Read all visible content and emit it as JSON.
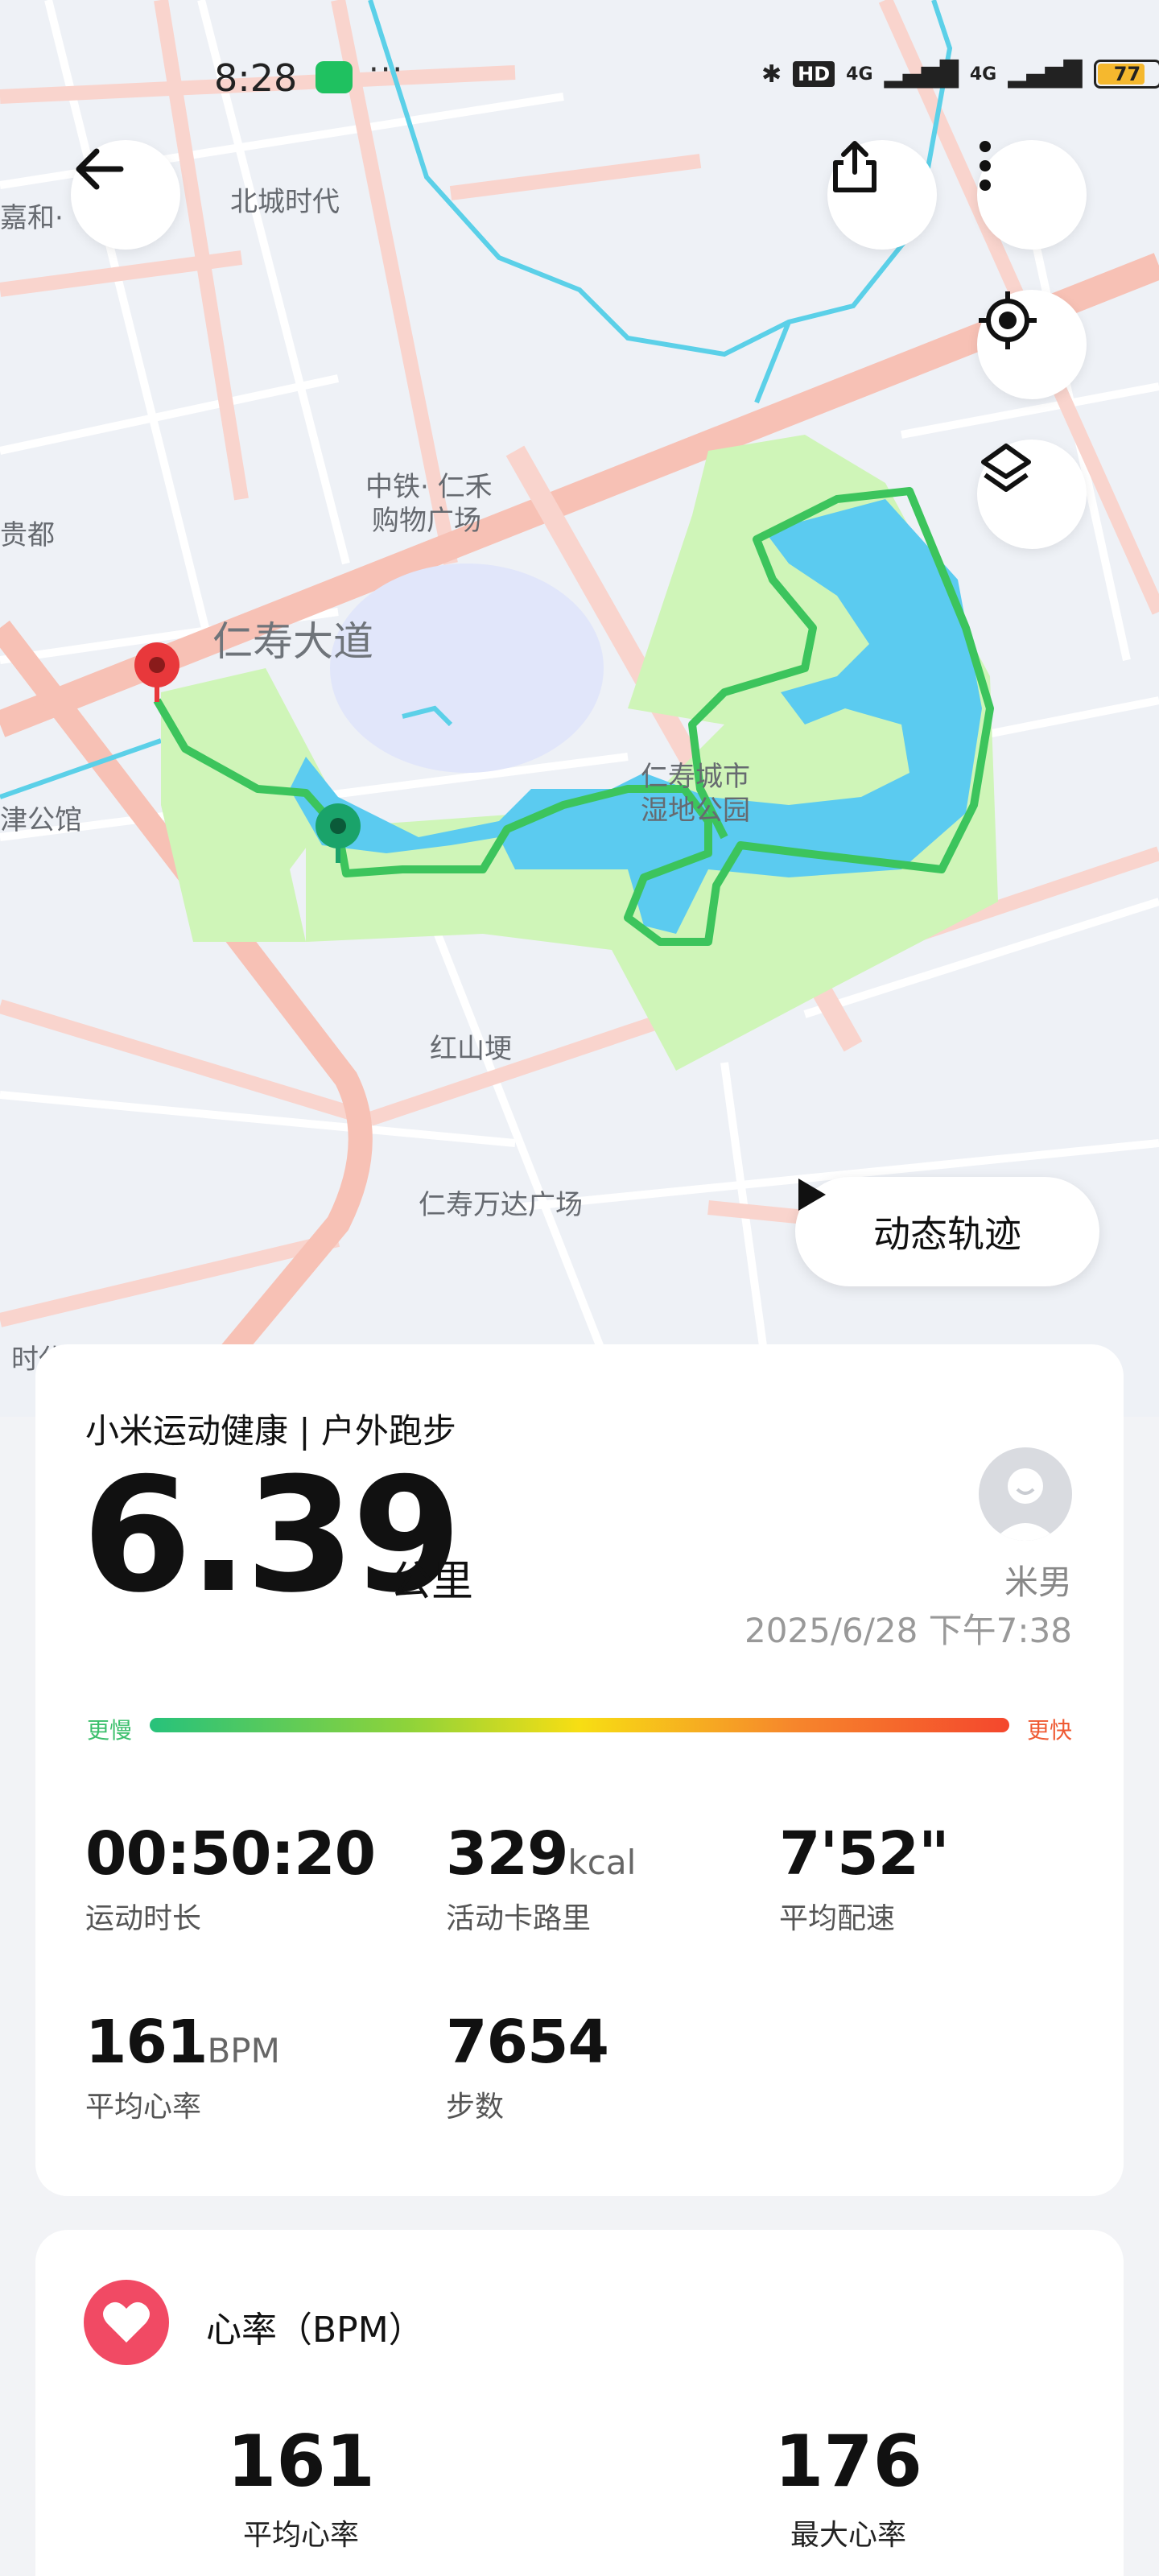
{
  "status_bar": {
    "time": "8:28",
    "more": "···",
    "hd": "HD",
    "signal1": "4G",
    "signal2": "4G",
    "battery": "77"
  },
  "map": {
    "labels": {
      "beicheng": "北城时代",
      "jiahe": "嘉和·",
      "guidu": "贵都",
      "zhongtie1": "中铁· 仁禾",
      "zhongtie2": "购物广场",
      "renshou_road": "仁寿大道",
      "wetland1": "仁寿城市",
      "wetland2": "湿地公园",
      "gongguan": "津公馆",
      "hongshan": "红山埂",
      "wanda": "仁寿万达广场",
      "shidai": "时代"
    },
    "replay_label": "动态轨迹"
  },
  "summary": {
    "source": "小米运动健康 | 户外跑步",
    "distance": "6.39",
    "distance_unit": "公里",
    "user_name": "米男",
    "datetime": "2025/6/28 下午7:38",
    "pace_slow": "更慢",
    "pace_fast": "更快"
  },
  "stats": {
    "duration": {
      "value": "00:50:20",
      "label": "运动时长"
    },
    "calories": {
      "value": "329",
      "unit": "kcal",
      "label": "活动卡路里"
    },
    "pace": {
      "value": "7'52\"",
      "label": "平均配速"
    },
    "avg_hr": {
      "value": "161",
      "unit": "BPM",
      "label": "平均心率"
    },
    "steps": {
      "value": "7654",
      "label": "步数"
    }
  },
  "heart_rate": {
    "title": "心率（BPM）",
    "avg": {
      "value": "161",
      "label": "平均心率"
    },
    "max": {
      "value": "176",
      "label": "最大心率"
    }
  },
  "colors": {
    "route": "#3cc45c",
    "start_pin": "#1aa36a",
    "end_pin": "#e8383b",
    "heart": "#f14a64"
  }
}
